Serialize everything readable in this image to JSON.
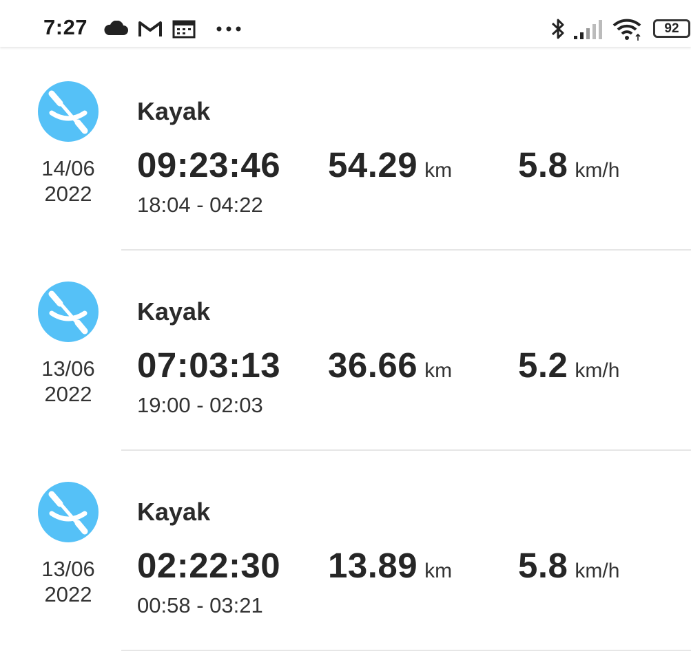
{
  "status_bar": {
    "time": "7:27",
    "left_icons": [
      "cloud-icon",
      "gmail-icon",
      "calendar-icon",
      "more-dots-icon"
    ],
    "right_icons": [
      "bluetooth-icon",
      "signal-icon",
      "wifi-icon",
      "battery-icon"
    ],
    "battery": "92"
  },
  "activities": [
    {
      "sport": "Kayak",
      "date_day": "14/06",
      "date_year": "2022",
      "duration": "09:23:46",
      "distance": "54.29",
      "distance_unit": "km",
      "speed": "5.8",
      "speed_unit": "km/h",
      "time_range": "18:04 - 04:22"
    },
    {
      "sport": "Kayak",
      "date_day": "13/06",
      "date_year": "2022",
      "duration": "07:03:13",
      "distance": "36.66",
      "distance_unit": "km",
      "speed": "5.2",
      "speed_unit": "km/h",
      "time_range": "19:00 - 02:03"
    },
    {
      "sport": "Kayak",
      "date_day": "13/06",
      "date_year": "2022",
      "duration": "02:22:30",
      "distance": "13.89",
      "distance_unit": "km",
      "speed": "5.8",
      "speed_unit": "km/h",
      "time_range": "00:58 - 03:21"
    }
  ],
  "colors": {
    "sport_icon_bg": "#55c1f7",
    "divider": "#e6e6e6"
  },
  "sport_icon": "kayak-icon"
}
